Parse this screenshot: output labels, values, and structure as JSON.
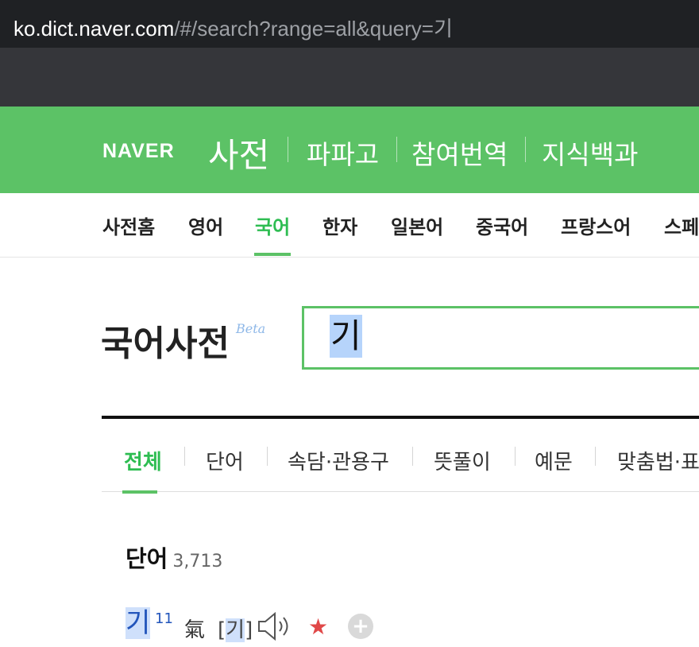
{
  "browser": {
    "url_host": "ko.dict.naver.com",
    "url_rest": "/#/search?range=all&query=기"
  },
  "header": {
    "logo": "NAVER",
    "service": "사전",
    "links": [
      "파파고",
      "참여번역",
      "지식백과"
    ]
  },
  "nav": {
    "items": [
      "사전홈",
      "영어",
      "국어",
      "한자",
      "일본어",
      "중국어",
      "프랑스어",
      "스페"
    ],
    "active": "국어"
  },
  "dictionary": {
    "title": "국어사전",
    "badge": "Beta",
    "query": "기"
  },
  "tabs": {
    "items": [
      "전체",
      "단어",
      "속담·관용구",
      "뜻풀이",
      "예문",
      "맞춤법·표"
    ],
    "active": "전체"
  },
  "results": {
    "section_title": "단어",
    "section_count": "3,713",
    "entry": {
      "word": "기",
      "homonym_number": "11",
      "hanja": "氣",
      "pron_open": "[",
      "pron": "기",
      "pron_close": "]",
      "icons": [
        "speaker-icon",
        "star-icon",
        "plus-icon"
      ]
    }
  },
  "colors": {
    "brand_green": "#5cc266",
    "active_green": "#2ebd52",
    "star_red": "#e04848",
    "link_blue": "#2255bb"
  }
}
